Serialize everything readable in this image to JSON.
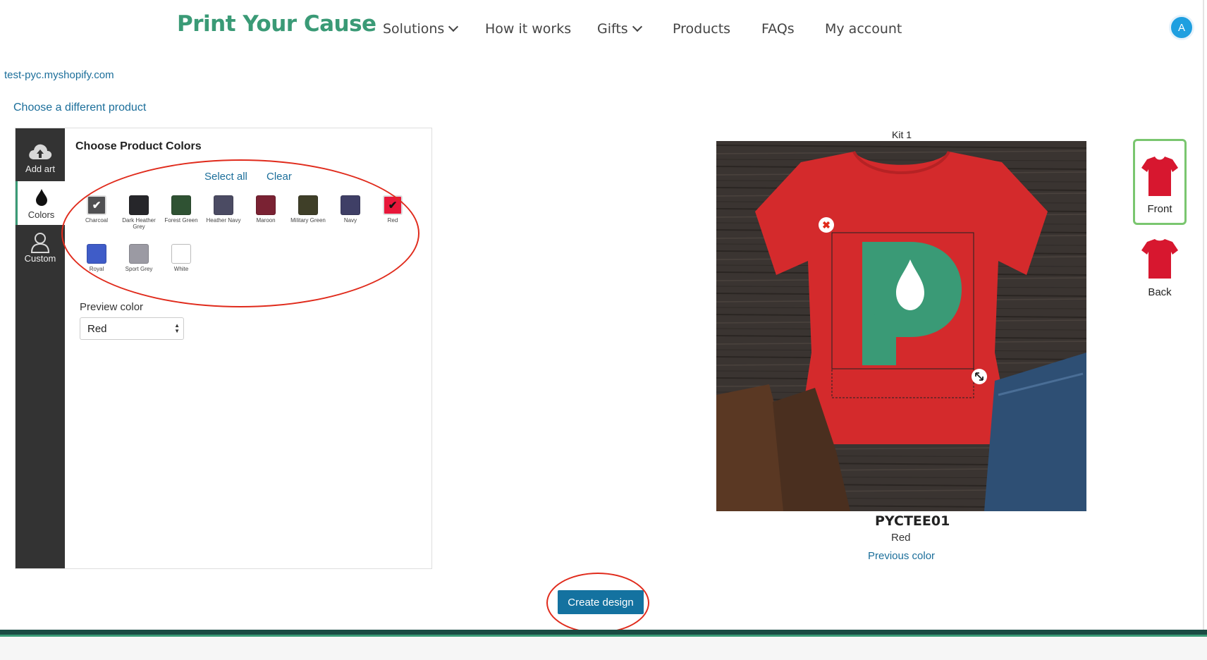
{
  "header": {
    "logo": "Print Your Cause",
    "nav": [
      {
        "label": "Solutions",
        "dropdown": true
      },
      {
        "label": "How it works",
        "dropdown": false
      },
      {
        "label": "Gifts",
        "dropdown": true
      },
      {
        "label": "Products",
        "dropdown": false
      },
      {
        "label": "FAQs",
        "dropdown": false
      },
      {
        "label": "My account",
        "dropdown": false
      }
    ],
    "avatar_initial": "A"
  },
  "store_link": "test-pyc.myshopify.com",
  "choose_product_link": "Choose a different product",
  "sidebar": {
    "items": [
      {
        "label": "Add art",
        "icon": "cloud-upload-icon"
      },
      {
        "label": "Colors",
        "icon": "drop-icon",
        "active": true
      },
      {
        "label": "Custom",
        "icon": "user-icon"
      }
    ]
  },
  "colors_panel": {
    "title": "Choose Product Colors",
    "select_all": "Select all",
    "clear": "Clear",
    "swatches": [
      {
        "name": "Charcoal",
        "color": "#505052",
        "checked": true
      },
      {
        "name": "Dark Heather Grey",
        "color": "#26262a",
        "checked": false
      },
      {
        "name": "Forest Green",
        "color": "#2f5233",
        "checked": false
      },
      {
        "name": "Heather Navy",
        "color": "#4b4b63",
        "checked": false
      },
      {
        "name": "Maroon",
        "color": "#7a2233",
        "checked": false
      },
      {
        "name": "Military Green",
        "color": "#3f3f28",
        "checked": false
      },
      {
        "name": "Navy",
        "color": "#3f3f66",
        "checked": false
      },
      {
        "name": "Red",
        "color": "#e8173a",
        "checked": true
      },
      {
        "name": "Royal",
        "color": "#3f5cc8",
        "checked": false
      },
      {
        "name": "Sport Grey",
        "color": "#9b9aa3",
        "checked": false
      },
      {
        "name": "White",
        "color": "#ffffff",
        "checked": false
      }
    ],
    "preview_label": "Preview color",
    "preview_value": "Red"
  },
  "preview": {
    "kit_title": "Kit 1",
    "sku": "PYCTEE01",
    "color": "Red",
    "previous_color": "Previous color",
    "views": [
      {
        "label": "Front",
        "active": true
      },
      {
        "label": "Back",
        "active": false
      }
    ]
  },
  "create_button": "Create design",
  "colors": {
    "brand_green": "#3a9a76",
    "link_blue": "#1b6e9a",
    "button_blue": "#1472a0",
    "annotation_red": "#e02b1c",
    "shirt_red": "#d42a2c"
  }
}
